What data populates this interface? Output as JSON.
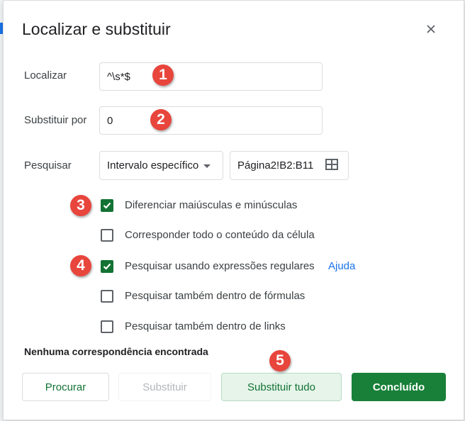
{
  "dialog": {
    "title": "Localizar e substituir"
  },
  "find": {
    "label": "Localizar",
    "value": "^\\s*$"
  },
  "replace": {
    "label": "Substituir por",
    "value": "0"
  },
  "search": {
    "label": "Pesquisar",
    "scope_value": "Intervalo específico",
    "range_value": "Página2!B2:B11"
  },
  "options": [
    {
      "label": "Diferenciar maiúsculas e minúsculas",
      "checked": true
    },
    {
      "label": "Corresponder todo o conteúdo da célula",
      "checked": false
    },
    {
      "label": "Pesquisar usando expressões regulares",
      "checked": true
    },
    {
      "label": "Pesquisar também dentro de fórmulas",
      "checked": false
    },
    {
      "label": "Pesquisar também dentro de links",
      "checked": false
    }
  ],
  "help_link": "Ajuda",
  "status": "Nenhuma correspondência encontrada",
  "buttons": {
    "find": "Procurar",
    "replace": "Substituir",
    "replace_all": "Substituir tudo",
    "done": "Concluído"
  },
  "callouts": [
    "1",
    "2",
    "3",
    "4",
    "5"
  ],
  "colors": {
    "accent_green": "#188038",
    "link_blue": "#1a73e8",
    "callout_red": "#e8453c"
  },
  "icons": {
    "close": "close-icon",
    "dropdown": "chevron-down-icon",
    "range": "grid-icon"
  }
}
